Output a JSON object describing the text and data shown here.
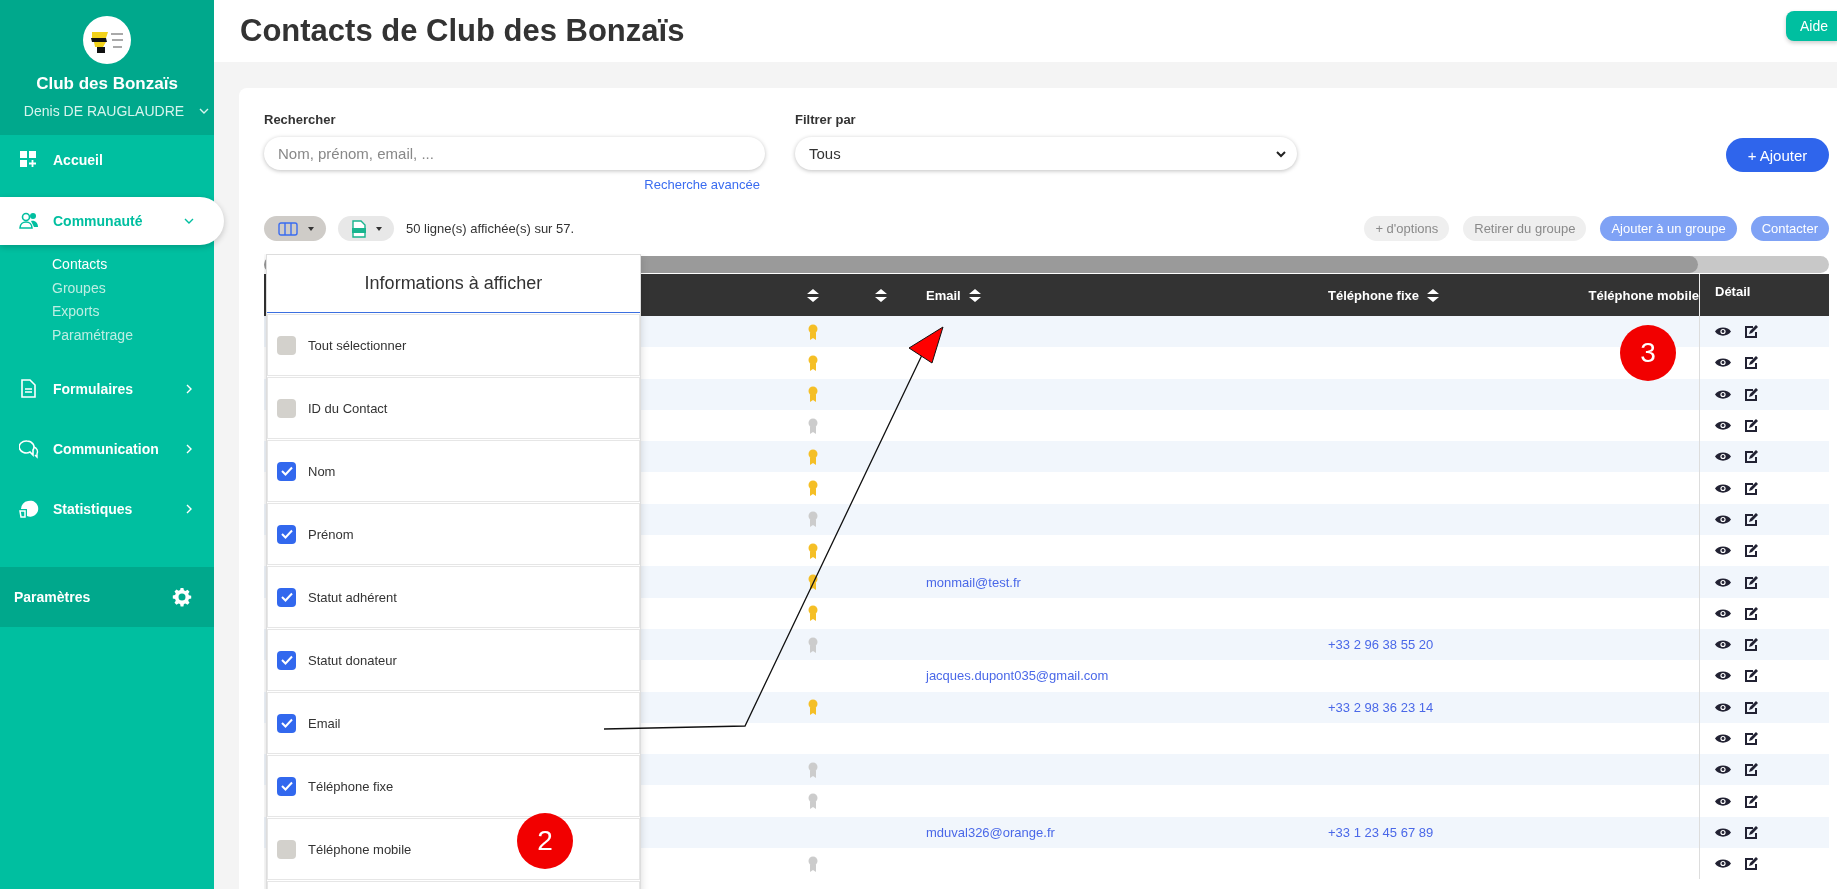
{
  "sidebar": {
    "org_name": "Club des Bonzaïs",
    "user_name": "Denis DE RAUGLAUDRE",
    "nav": [
      {
        "label": "Accueil",
        "kind": "link",
        "selected": false
      },
      {
        "label": "Communauté",
        "kind": "group",
        "selected": true,
        "expanded": true,
        "children": [
          {
            "label": "Contacts",
            "selected": true
          },
          {
            "label": "Groupes",
            "selected": false
          },
          {
            "label": "Exports",
            "selected": false
          },
          {
            "label": "Paramétrage",
            "selected": false
          }
        ]
      },
      {
        "label": "Formulaires",
        "kind": "group",
        "selected": false,
        "expanded": false
      },
      {
        "label": "Communication",
        "kind": "group",
        "selected": false,
        "expanded": false
      },
      {
        "label": "Statistiques",
        "kind": "group",
        "selected": false,
        "expanded": false
      }
    ],
    "settings_label": "Paramètres"
  },
  "header": {
    "title": "Contacts de Club des Bonzaïs",
    "help_button": "Aide"
  },
  "search": {
    "label": "Rechercher",
    "placeholder": "Nom, prénom, email, ...",
    "advanced_link": "Recherche avancée"
  },
  "filter": {
    "label": "Filtrer par",
    "value": "Tous"
  },
  "add_button": "+ Ajouter",
  "toolbar": {
    "row_count": "50 ligne(s) affichée(s) sur 57.",
    "actions": [
      {
        "label": "+ d'options",
        "disabled": true
      },
      {
        "label": "Retirer du groupe",
        "disabled": true
      },
      {
        "label": "Ajouter à un groupe",
        "disabled": false
      },
      {
        "label": "Contacter",
        "disabled": false
      }
    ]
  },
  "column_picker": {
    "title": "Informations à afficher",
    "items": [
      {
        "label": "Tout sélectionner",
        "checked": false
      },
      {
        "label": "ID du Contact",
        "checked": false
      },
      {
        "label": "Nom",
        "checked": true
      },
      {
        "label": "Prénom",
        "checked": true
      },
      {
        "label": "Statut adhérent",
        "checked": true
      },
      {
        "label": "Statut donateur",
        "checked": true
      },
      {
        "label": "Email",
        "checked": true
      },
      {
        "label": "Téléphone fixe",
        "checked": true
      },
      {
        "label": "Téléphone mobile",
        "checked": false
      }
    ]
  },
  "table": {
    "columns": [
      {
        "sortable": true
      },
      {
        "sortable": true
      },
      {
        "label": "Email",
        "sortable": true
      },
      {
        "label": "Téléphone fixe",
        "sortable": true
      },
      {
        "label": "Téléphone mobile",
        "sortable": false
      },
      {
        "label": "Détail",
        "sortable": false
      }
    ],
    "rows": [
      {
        "medal": {
          "color": "#f5bf26"
        }
      },
      {
        "medal": {
          "color": "#f5bf26"
        }
      },
      {
        "medal": {
          "color": "#f5bf26"
        }
      },
      {
        "medal": {
          "color": "#cccccc"
        }
      },
      {
        "medal": {
          "color": "#f5bf26"
        }
      },
      {
        "medal": {
          "color": "#f5bf26"
        }
      },
      {
        "medal": {
          "color": "#cccccc"
        }
      },
      {
        "medal": {
          "color": "#f5bf26"
        }
      },
      {
        "medal": {
          "color": "#f5bf26"
        },
        "email": "monmail@test.fr"
      },
      {
        "medal": {
          "color": "#f5bf26"
        }
      },
      {
        "medal": {
          "color": "#cccccc"
        },
        "phone": "+33 2 96 38 55 20"
      },
      {
        "email": "jacques.dupont035@gmail.com"
      },
      {
        "medal": {
          "color": "#f5bf26"
        },
        "phone": "+33 2 98 36 23 14"
      },
      {},
      {
        "medal": {
          "color": "#cccccc"
        }
      },
      {
        "medal": {
          "color": "#cccccc"
        }
      },
      {
        "email": "mduval326@orange.fr",
        "phone": "+33 1 23 45 67 89"
      },
      {
        "medal": {
          "color": "#cccccc"
        }
      }
    ]
  },
  "annotations": {
    "markers": [
      "2",
      "3"
    ]
  }
}
